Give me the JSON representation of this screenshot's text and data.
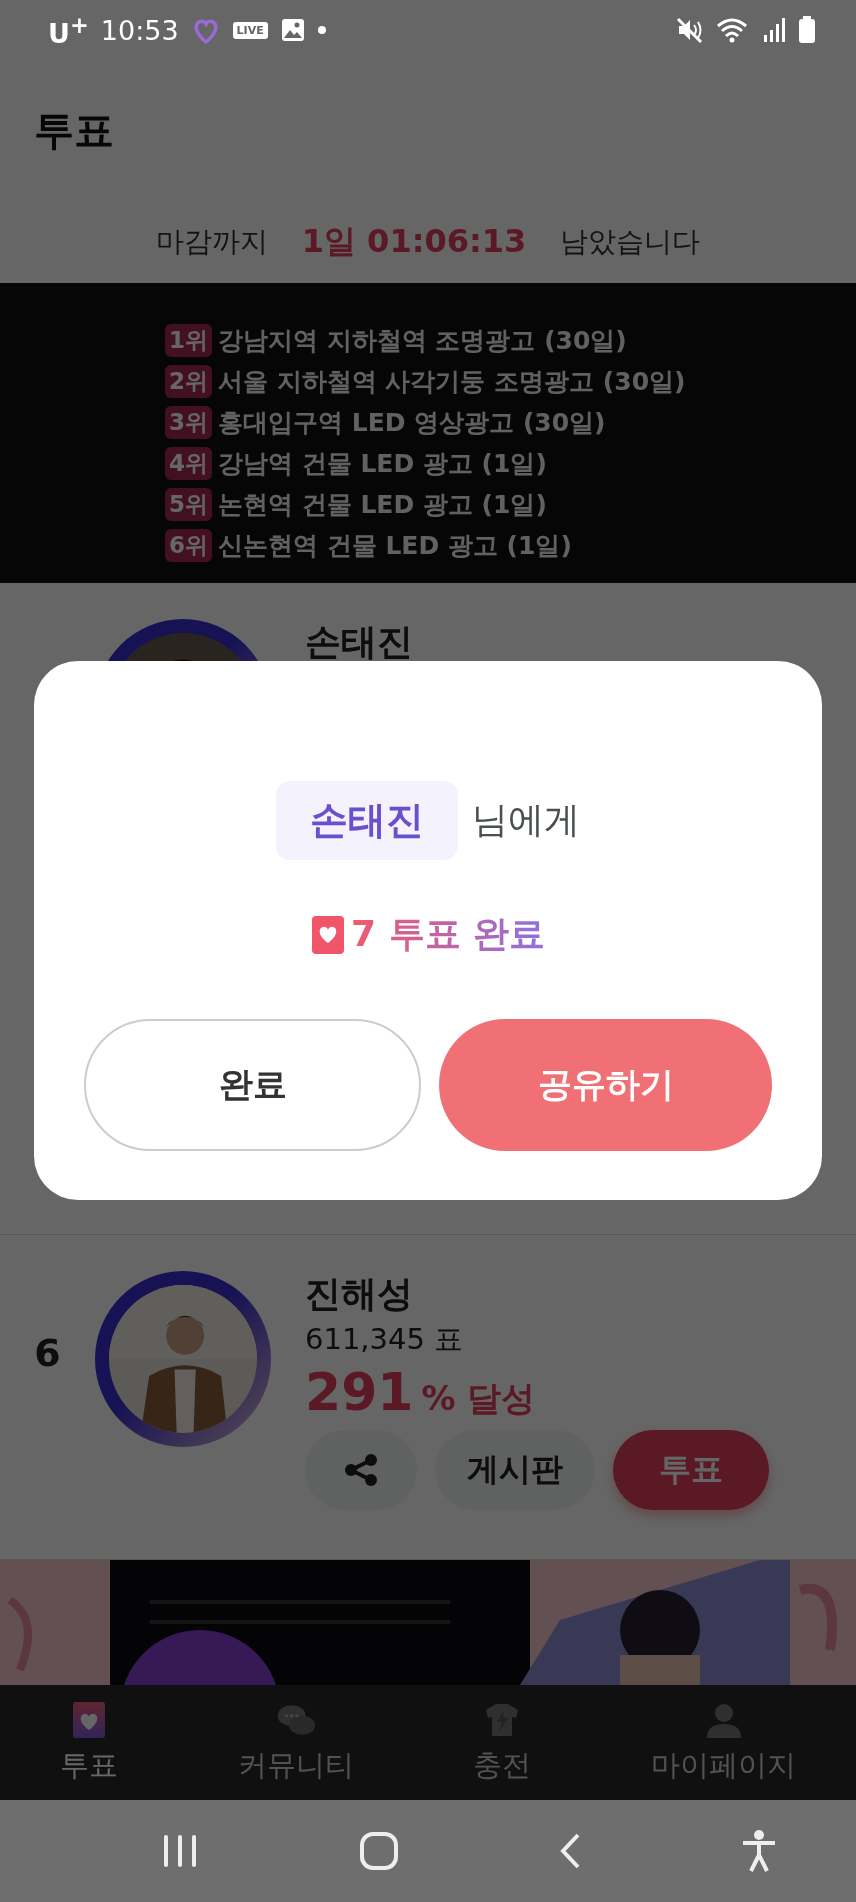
{
  "status_bar": {
    "carrier": "U$^{+}$",
    "time": "10:53",
    "live_badge": "LIVE"
  },
  "header": {
    "title": "투표"
  },
  "countdown": {
    "prefix": "마감까지",
    "time": "1일 01:06:13",
    "suffix": "남았습니다"
  },
  "prize_banner": {
    "items": [
      {
        "rank": "1위",
        "text": "강남지역 지하철역 조명광고 (30일)"
      },
      {
        "rank": "2위",
        "text": "서울 지하철역 사각기둥 조명광고 (30일)"
      },
      {
        "rank": "3위",
        "text": "홍대입구역 LED 영상광고 (30일)"
      },
      {
        "rank": "4위",
        "text": "강남역 건물 LED 광고 (1일)"
      },
      {
        "rank": "5위",
        "text": "논현역 건물 LED 광고 (1일)"
      },
      {
        "rank": "6위",
        "text": "신논현역 건물 LED 광고 (1일)"
      }
    ]
  },
  "candidates": [
    {
      "kind": "covered",
      "name": "손태진"
    },
    {
      "kind": "full",
      "rank": "6",
      "name": "진해성",
      "votes": "611,345 표",
      "percent": "291",
      "percent_suffix": "% 달성",
      "board_button": "게시판",
      "vote_button": "투표"
    }
  ],
  "dialog": {
    "name": "손태진",
    "name_suffix": "님에게",
    "result": "7 투표 완료",
    "buttons": [
      {
        "label": "완료",
        "kind": "outline"
      },
      {
        "label": "공유하기",
        "kind": "primary"
      }
    ]
  },
  "bottom_nav": [
    {
      "label": "투표",
      "kind": "vote",
      "selected": true
    },
    {
      "label": "커뮤니티",
      "kind": "community",
      "selected": false
    },
    {
      "label": "충전",
      "kind": "charge",
      "selected": false
    },
    {
      "label": "마이페이지",
      "kind": "mypage",
      "selected": false
    }
  ]
}
